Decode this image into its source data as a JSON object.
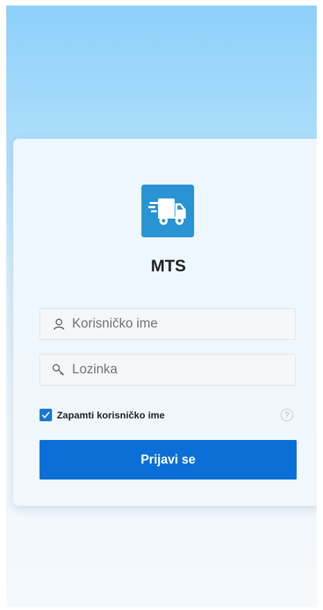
{
  "app": {
    "name": "MTS",
    "logo_icon": "delivery-truck-icon",
    "logo_color": "#2a93d3"
  },
  "login": {
    "username_placeholder": "Korisničko ime",
    "username_icon": "user-icon",
    "password_placeholder": "Lozinka",
    "password_icon": "key-icon",
    "remember_label": "Zapamti korisničko ime",
    "remember_checked": true,
    "help_icon": "question-circle-icon",
    "submit_label": "Prijavi se",
    "accent_color": "#0a6fd6"
  }
}
